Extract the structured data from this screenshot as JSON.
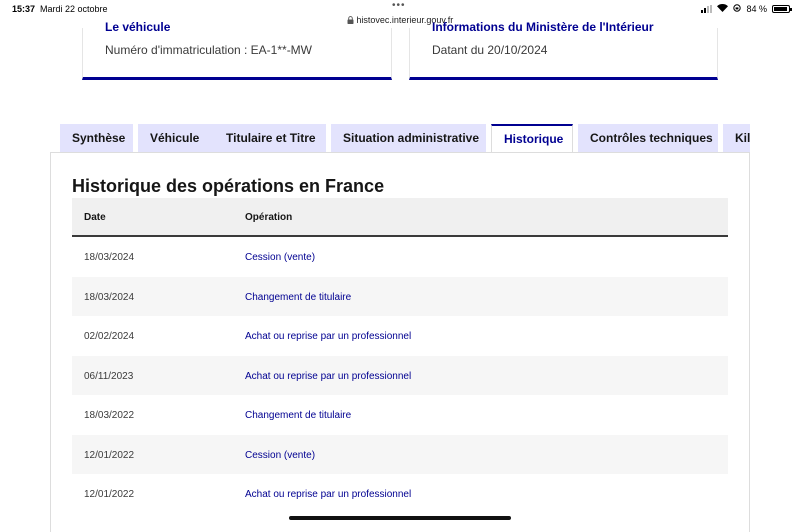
{
  "status_bar": {
    "time": "15:37",
    "date": "Mardi 22 octobre",
    "url": "histovec.interieur.gouv.fr",
    "battery": "84 %"
  },
  "cards": [
    {
      "title": "Le véhicule",
      "text": "Numéro d'immatriculation : EA-1**-MW"
    },
    {
      "title": "Informations du Ministère de l'Intérieur",
      "text": "Datant du 20/10/2024"
    }
  ],
  "tabs": [
    {
      "label": "Synthèse",
      "active": false
    },
    {
      "label": "Véhicule",
      "active": false
    },
    {
      "label": "Titulaire et Titre",
      "active": false
    },
    {
      "label": "Situation administrative",
      "active": false
    },
    {
      "label": "Historique",
      "active": true
    },
    {
      "label": "Contrôles techniques",
      "active": false
    },
    {
      "label": "Kilométrage",
      "active": false
    }
  ],
  "section": {
    "title": "Historique des opérations en France"
  },
  "table": {
    "headers": {
      "date": "Date",
      "operation": "Opération"
    },
    "rows": [
      {
        "date": "18/03/2024",
        "operation": "Cession (vente)"
      },
      {
        "date": "18/03/2024",
        "operation": "Changement de titulaire"
      },
      {
        "date": "02/02/2024",
        "operation": "Achat ou reprise par un professionnel"
      },
      {
        "date": "06/11/2023",
        "operation": "Achat ou reprise par un professionnel"
      },
      {
        "date": "18/03/2022",
        "operation": "Changement de titulaire"
      },
      {
        "date": "12/01/2022",
        "operation": "Cession (vente)"
      },
      {
        "date": "12/01/2022",
        "operation": "Achat ou reprise par un professionnel"
      }
    ]
  },
  "colors": {
    "accent": "#000091",
    "tab_bg": "#e3e3fd",
    "header_bg": "#f0f0f0"
  }
}
